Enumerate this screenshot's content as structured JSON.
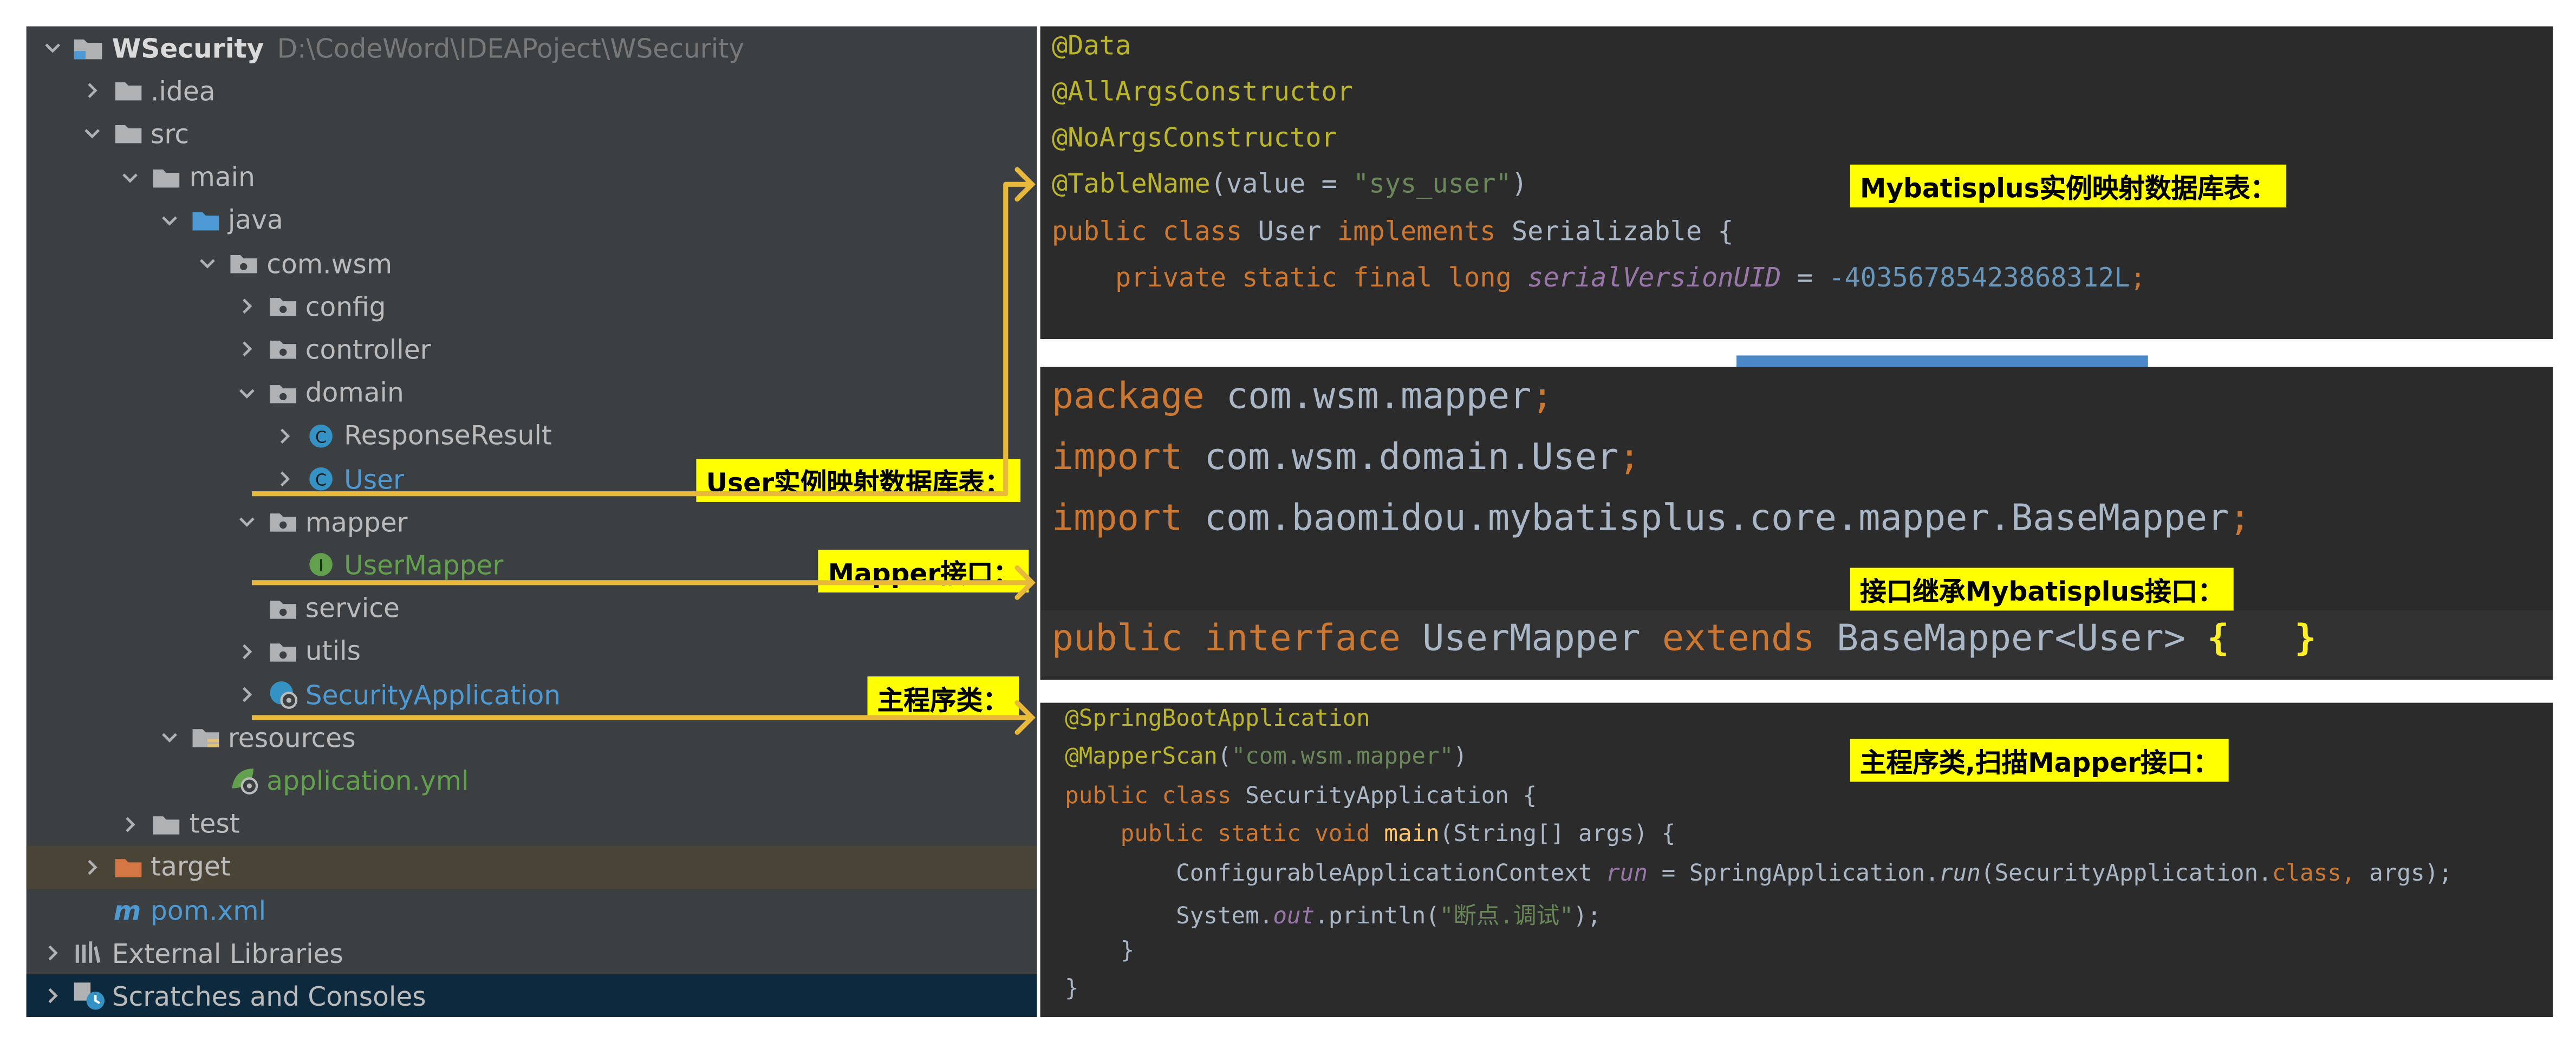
{
  "tree": {
    "rows": [
      {
        "label": "WSecurity",
        "path": "D:\\CodeWord\\IDEAPoject\\WSecurity",
        "icon": "module-folder-icon",
        "arrow": "down",
        "indent": 0,
        "style": "bold"
      },
      {
        "label": ".idea",
        "icon": "folder-icon",
        "arrow": "right",
        "indent": 1
      },
      {
        "label": "src",
        "icon": "folder-icon",
        "arrow": "down",
        "indent": 1
      },
      {
        "label": "main",
        "icon": "folder-icon",
        "arrow": "down",
        "indent": 2
      },
      {
        "label": "java",
        "icon": "source-folder-icon",
        "arrow": "down",
        "indent": 3
      },
      {
        "label": "com.wsm",
        "icon": "package-icon",
        "arrow": "down",
        "indent": 4
      },
      {
        "label": "config",
        "icon": "package-icon",
        "arrow": "right",
        "indent": 5
      },
      {
        "label": "controller",
        "icon": "package-icon",
        "arrow": "right",
        "indent": 5
      },
      {
        "label": "domain",
        "icon": "package-icon",
        "arrow": "down",
        "indent": 5
      },
      {
        "label": "ResponseResult",
        "icon": "class-icon",
        "arrow": "right",
        "indent": 6
      },
      {
        "label": "User",
        "icon": "class-icon",
        "arrow": "right",
        "indent": 6,
        "style": "blue"
      },
      {
        "label": "mapper",
        "icon": "package-icon",
        "arrow": "down",
        "indent": 5
      },
      {
        "label": "UserMapper",
        "icon": "interface-icon",
        "arrow": "none",
        "indent": 6,
        "style": "green"
      },
      {
        "label": "service",
        "icon": "package-icon",
        "arrow": "none",
        "indent": 5
      },
      {
        "label": "utils",
        "icon": "package-icon",
        "arrow": "right",
        "indent": 5
      },
      {
        "label": "SecurityApplication",
        "icon": "spring-boot-class-icon",
        "arrow": "right",
        "indent": 5,
        "style": "blue"
      },
      {
        "label": "resources",
        "icon": "resources-folder-icon",
        "arrow": "down",
        "indent": 3
      },
      {
        "label": "application.yml",
        "icon": "spring-config-icon",
        "arrow": "none",
        "indent": 4,
        "style": "green"
      },
      {
        "label": "test",
        "icon": "folder-icon",
        "arrow": "right",
        "indent": 2
      },
      {
        "label": "target",
        "icon": "excluded-folder-icon",
        "arrow": "right",
        "indent": 1,
        "row": "hl"
      },
      {
        "label": "pom.xml",
        "icon": "maven-icon",
        "arrow": "none",
        "indent": 1,
        "style": "blue"
      },
      {
        "label": "External Libraries",
        "icon": "libraries-icon",
        "arrow": "right",
        "indent": 0
      },
      {
        "label": "Scratches and Consoles",
        "icon": "scratches-icon",
        "arrow": "right",
        "indent": 0,
        "row": "sel"
      }
    ]
  },
  "annotations": {
    "user_table": "User实例映射数据库表：",
    "mapper_iface": "Mapper接口：",
    "main_class": "主程序类：",
    "mp_entity": "Mybatisplus实例映射数据库表：",
    "mp_extends": "接口继承Mybatisplus接口：",
    "main_scan": "主程序类,扫描Mapper接口："
  },
  "code1": {
    "l1": "@Data",
    "l2": "@AllArgsConstructor",
    "l3": "@NoArgsConstructor",
    "l4": [
      {
        "t": "@TableName",
        "c": "c-ann"
      },
      {
        "t": "(value = ",
        "c": "c-def"
      },
      {
        "t": "\"sys_user\"",
        "c": "c-str"
      },
      {
        "t": ")",
        "c": "c-def"
      }
    ],
    "l5": [
      {
        "t": "public class ",
        "c": "c-kw"
      },
      {
        "t": "User ",
        "c": "c-def"
      },
      {
        "t": "implements ",
        "c": "c-kw"
      },
      {
        "t": "Serializable {",
        "c": "c-def"
      }
    ],
    "l6": [
      {
        "t": "    private static final long ",
        "c": "c-kw"
      },
      {
        "t": "serialVersionUID",
        "c": "c-field"
      },
      {
        "t": " = ",
        "c": "c-def"
      },
      {
        "t": "-40356785423868312L",
        "c": "c-num"
      },
      {
        "t": ";",
        "c": "c-kw"
      }
    ]
  },
  "code2": {
    "l1": [
      {
        "t": "package ",
        "c": "c-kw"
      },
      {
        "t": "com.wsm.mapper",
        "c": "c-def"
      },
      {
        "t": ";",
        "c": "c-kw"
      }
    ],
    "l2": [
      {
        "t": "import ",
        "c": "c-kw"
      },
      {
        "t": "com.wsm.domain.User",
        "c": "c-def"
      },
      {
        "t": ";",
        "c": "c-kw"
      }
    ],
    "l3": [
      {
        "t": "import ",
        "c": "c-kw"
      },
      {
        "t": "com.baomidou.mybatisplus.core.mapper.BaseMapper",
        "c": "c-def"
      },
      {
        "t": ";",
        "c": "c-kw"
      }
    ],
    "l4": [
      {
        "t": "public interface ",
        "c": "c-kw"
      },
      {
        "t": "UserMapper ",
        "c": "c-def"
      },
      {
        "t": "extends ",
        "c": "c-kw"
      },
      {
        "t": "BaseMapper<User> ",
        "c": "c-def"
      },
      {
        "t": "{",
        "c": "c-brace"
      },
      {
        "t": "   ",
        "c": "c-def"
      },
      {
        "t": "}",
        "c": "c-brace"
      }
    ]
  },
  "code3": {
    "l1": [
      {
        "t": "@SpringBootApplication",
        "c": "c-ann"
      }
    ],
    "l2": [
      {
        "t": "@MapperScan",
        "c": "c-ann"
      },
      {
        "t": "(",
        "c": "c-def"
      },
      {
        "t": "\"com.wsm.mapper\"",
        "c": "c-str"
      },
      {
        "t": ")",
        "c": "c-def"
      }
    ],
    "l3": [
      {
        "t": "public class ",
        "c": "c-kw"
      },
      {
        "t": "SecurityApplication {",
        "c": "c-def"
      }
    ],
    "l4": [
      {
        "t": "    public static void ",
        "c": "c-kw"
      },
      {
        "t": "main",
        "c": "c-fn"
      },
      {
        "t": "(String[] args) {",
        "c": "c-def"
      }
    ],
    "l5": [
      {
        "t": "        ConfigurableApplicationContext ",
        "c": "c-def"
      },
      {
        "t": "run",
        "c": "c-static"
      },
      {
        "t": " = SpringApplication.",
        "c": "c-def"
      },
      {
        "t": "run",
        "c": "c-def c-ital"
      },
      {
        "t": "(SecurityApplication.",
        "c": "c-def"
      },
      {
        "t": "class",
        "c": "c-kw"
      },
      {
        "t": ", ",
        "c": "c-kw"
      },
      {
        "t": "args);",
        "c": "c-def"
      }
    ],
    "l6": [
      {
        "t": "        System.",
        "c": "c-def"
      },
      {
        "t": "out",
        "c": "c-static"
      },
      {
        "t": ".println(",
        "c": "c-def"
      },
      {
        "t": "\"断点.调试\"",
        "c": "c-str"
      },
      {
        "t": ");",
        "c": "c-def"
      }
    ],
    "l7": [
      {
        "t": "    }",
        "c": "c-def"
      }
    ],
    "l8": [
      {
        "t": "}",
        "c": "c-def"
      }
    ]
  },
  "colors": {
    "annotation_bg": "#ffff00",
    "arrow": "#e8b93a",
    "tree_bg": "#3c3f41",
    "editor_bg": "#2b2b2b"
  }
}
